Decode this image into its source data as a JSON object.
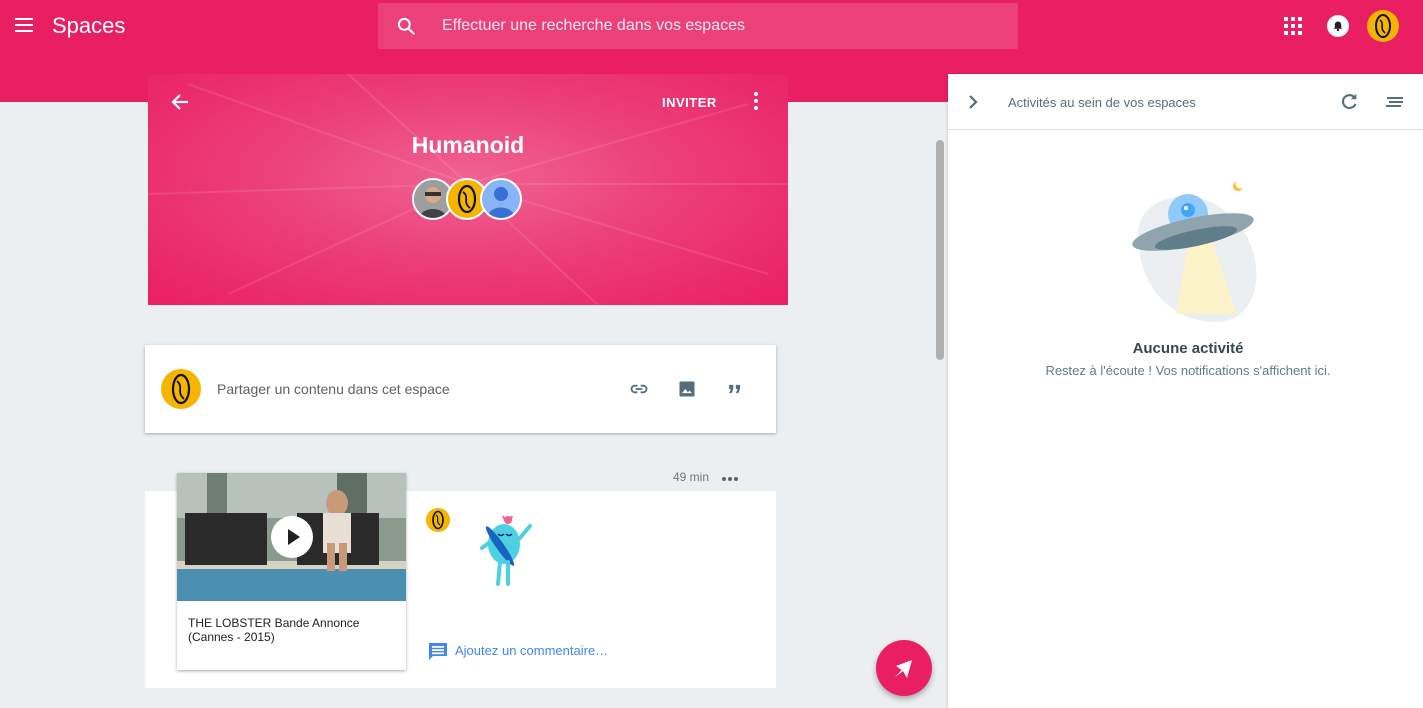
{
  "app": {
    "title": "Spaces",
    "menu_icon": "hamburger-menu-icon",
    "apps_icon": "apps-grid-icon",
    "notifications_icon": "bell-icon"
  },
  "search": {
    "placeholder": "Effectuer une recherche dans vos espaces",
    "icon": "search-icon"
  },
  "space": {
    "name": "Humanoid",
    "invite_label": "INVITER",
    "back_icon": "arrow-back-icon",
    "more_icon": "more-vert-icon",
    "members": [
      "member-avatar-photo",
      "member-avatar-yellow",
      "member-avatar-default"
    ]
  },
  "composer": {
    "placeholder": "Partager un contenu dans cet espace",
    "icons": [
      "link-icon",
      "image-icon",
      "quote-icon"
    ]
  },
  "post": {
    "time": "49 min",
    "more_icon": "more-horiz-icon",
    "video_title": "THE LOBSTER Bande Annonce (Cannes - 2015)",
    "comment_label": "Ajoutez un commentaire…",
    "comment_icon": "comment-icon"
  },
  "fab": {
    "icon": "send-icon"
  },
  "activity_panel": {
    "title": "Activités au sein de vos espaces",
    "collapse_icon": "chevron-right-icon",
    "refresh_icon": "refresh-icon",
    "sort_icon": "sort-icon",
    "empty_title": "Aucune activité",
    "empty_subtitle": "Restez à l'écoute ! Vos notifications s'affichent ici."
  },
  "colors": {
    "primary": "#e91e63",
    "search_bg": "#ec407a",
    "accent_yellow": "#f4b400",
    "link_blue": "#4285f4",
    "background": "#eceff1"
  }
}
